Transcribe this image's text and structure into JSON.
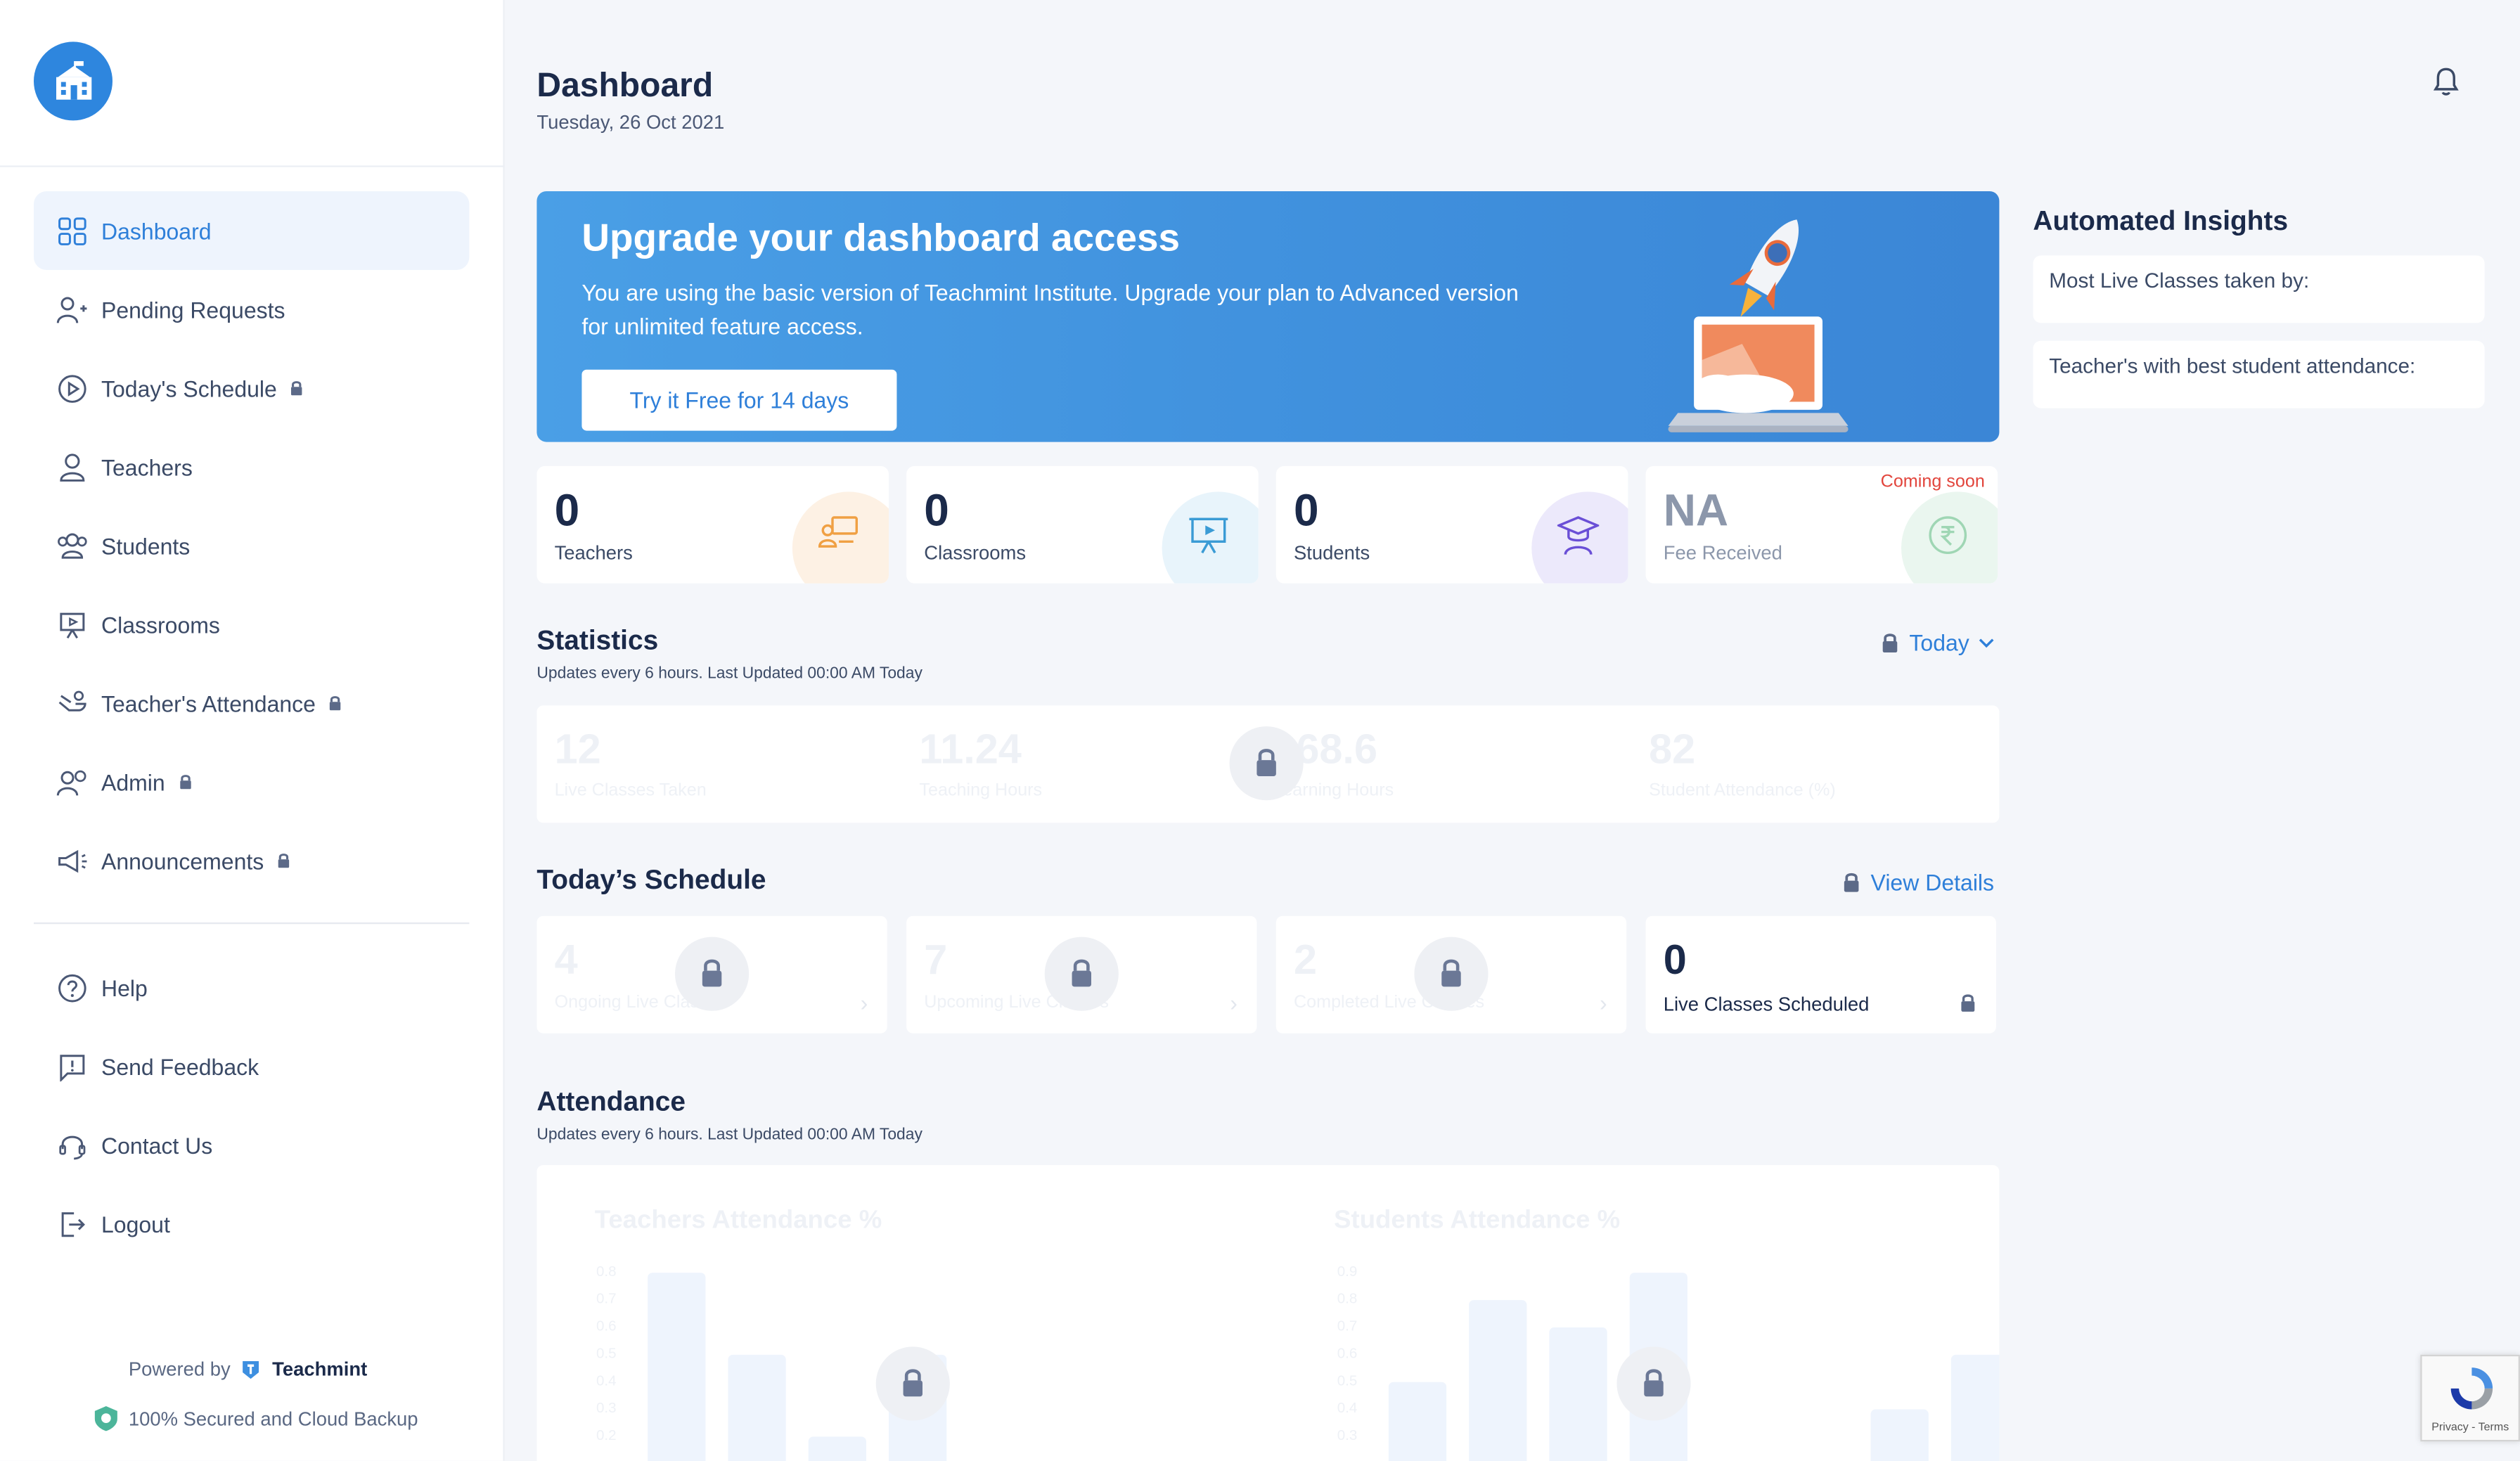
{
  "header": {
    "title": "Dashboard",
    "date": "Tuesday, 26 Oct 2021"
  },
  "sidebar": {
    "items": [
      {
        "label": "Dashboard",
        "icon": "grid-icon",
        "locked": false,
        "active": true
      },
      {
        "label": "Pending Requests",
        "icon": "user-plus-icon",
        "locked": false
      },
      {
        "label": "Today's Schedule",
        "icon": "play-circle-icon",
        "locked": true
      },
      {
        "label": "Teachers",
        "icon": "user-icon",
        "locked": false
      },
      {
        "label": "Students",
        "icon": "users-icon",
        "locked": false
      },
      {
        "label": "Classrooms",
        "icon": "presentation-icon",
        "locked": false
      },
      {
        "label": "Teacher's Attendance",
        "icon": "hand-icon",
        "locked": true
      },
      {
        "label": "Admin",
        "icon": "admin-icon",
        "locked": true
      },
      {
        "label": "Announcements",
        "icon": "megaphone-icon",
        "locked": true
      }
    ],
    "bottom_items": [
      {
        "label": "Help",
        "icon": "help-icon"
      },
      {
        "label": "Send Feedback",
        "icon": "feedback-icon"
      },
      {
        "label": "Contact Us",
        "icon": "headset-icon"
      },
      {
        "label": "Logout",
        "icon": "logout-icon"
      }
    ],
    "powered_by": "Powered by",
    "brand": "Teachmint",
    "secured": "100% Secured and Cloud Backup"
  },
  "banner": {
    "title": "Upgrade your dashboard access",
    "text": "You are using the basic version of Teachmint Institute. Upgrade your plan to Advanced version for unlimited feature access.",
    "button": "Try it Free for 14 days"
  },
  "stats": [
    {
      "value": "0",
      "label": "Teachers",
      "color": "#fdf1e4",
      "icon": "teacher-icon"
    },
    {
      "value": "0",
      "label": "Classrooms",
      "color": "#e8f4fb",
      "icon": "presentation-icon"
    },
    {
      "value": "0",
      "label": "Students",
      "color": "#ece9fb",
      "icon": "graduate-icon"
    },
    {
      "value": "NA",
      "label": "Fee Received",
      "color": "#eaf6ef",
      "icon": "rupee-icon",
      "badge": "Coming soon"
    }
  ],
  "statistics": {
    "title": "Statistics",
    "subtitle": "Updates every 6 hours. Last Updated 00:00 AM Today",
    "period": "Today",
    "items": [
      {
        "value": "12",
        "label": "Live Classes Taken"
      },
      {
        "value": "11.24",
        "label": "Teaching Hours"
      },
      {
        "value": "168.6",
        "label": "Learning Hours"
      },
      {
        "value": "82",
        "label": "Student Attendance (%)"
      }
    ]
  },
  "schedule": {
    "title": "Today’s Schedule",
    "link": "View Details",
    "items": [
      {
        "value": "4",
        "label": "Ongoing Live Classes"
      },
      {
        "value": "7",
        "label": "Upcoming Live Classes"
      },
      {
        "value": "2",
        "label": "Completed Live Classes"
      },
      {
        "value": "0",
        "label": "Live Classes Scheduled"
      }
    ]
  },
  "attendance": {
    "title": "Attendance",
    "subtitle": "Updates every 6 hours. Last Updated 00:00 AM Today",
    "charts": [
      {
        "title": "Teachers Attendance %",
        "ticks": [
          "0.8",
          "0.7",
          "0.6",
          "0.5",
          "0.4",
          "0.3",
          "0.2"
        ],
        "values": [
          0.8,
          0.5,
          0.2,
          0.5
        ]
      },
      {
        "title": "Students Attendance %",
        "ticks": [
          "0.9",
          "0.8",
          "0.7",
          "0.6",
          "0.5",
          "0.4",
          "0.3"
        ],
        "values": [
          0.5,
          0.8,
          0.7,
          0.9,
          0.2,
          0.4,
          0.6
        ]
      }
    ]
  },
  "insights": {
    "title": "Automated Insights",
    "items": [
      "Most Live Classes taken by:",
      "Teacher's with best student attendance:"
    ]
  },
  "recaptcha": "Privacy - Terms"
}
